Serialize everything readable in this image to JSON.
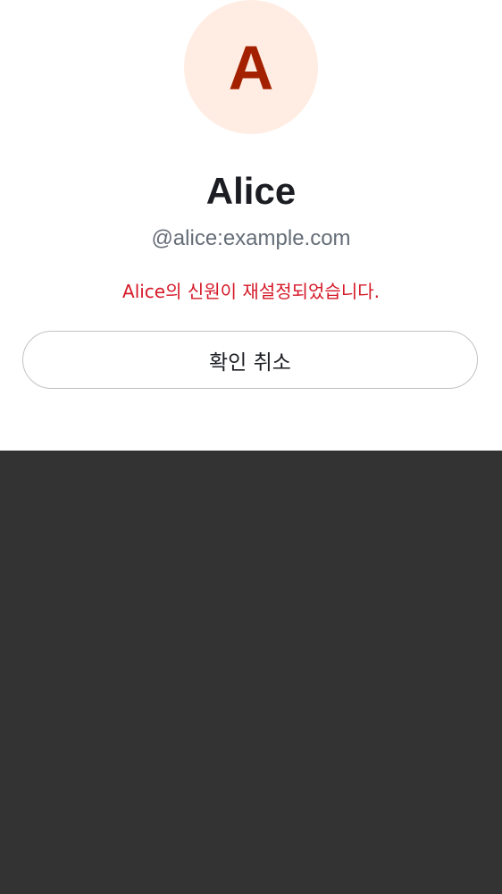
{
  "profile": {
    "avatar_letter": "A",
    "display_name": "Alice",
    "user_id": "@alice:example.com"
  },
  "status": {
    "message": "Alice의 신원이 재설정되었습니다."
  },
  "actions": {
    "confirm_label": "확인 취소"
  },
  "colors": {
    "avatar_background": "#ffede3",
    "avatar_text": "#a32100",
    "message": "#d51928",
    "backdrop": "#333333"
  }
}
